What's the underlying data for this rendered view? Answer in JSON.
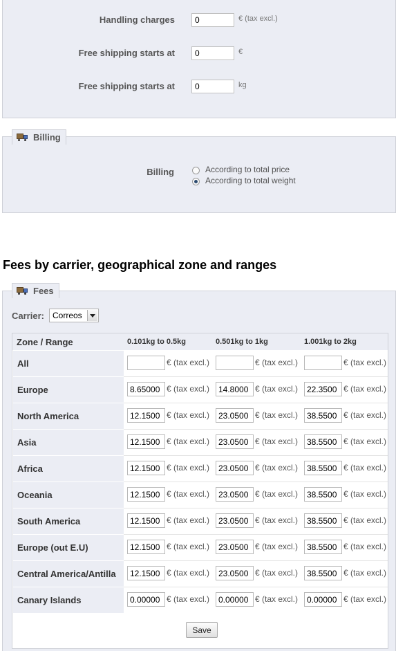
{
  "shipping": {
    "handling_label": "Handling charges",
    "handling_value": "0",
    "handling_unit": "€ (tax excl.)",
    "free_price_label": "Free shipping starts at",
    "free_price_value": "0",
    "free_price_unit": "€",
    "free_weight_label": "Free shipping starts at",
    "free_weight_value": "0",
    "free_weight_unit": "kg"
  },
  "billing": {
    "legend": "Billing",
    "label": "Billing",
    "options": [
      "According to total price",
      "According to total weight"
    ],
    "selected_index": 1
  },
  "fees": {
    "section_title": "Fees by carrier, geographical zone and ranges",
    "legend": "Fees",
    "carrier_label": "Carrier:",
    "carrier_value": "Correos",
    "header_zone": "Zone / Range",
    "ranges": [
      "0.101kg to 0.5kg",
      "0.501kg to 1kg",
      "1.001kg to 2kg"
    ],
    "unit": "€ (tax excl.)",
    "rows": [
      {
        "zone": "All",
        "values": [
          "",
          "",
          ""
        ]
      },
      {
        "zone": "Europe",
        "values": [
          "8.65000",
          "14.8000",
          "22.3500"
        ]
      },
      {
        "zone": "North America",
        "values": [
          "12.1500",
          "23.0500",
          "38.5500"
        ]
      },
      {
        "zone": "Asia",
        "values": [
          "12.1500",
          "23.0500",
          "38.5500"
        ]
      },
      {
        "zone": "Africa",
        "values": [
          "12.1500",
          "23.0500",
          "38.5500"
        ]
      },
      {
        "zone": "Oceania",
        "values": [
          "12.1500",
          "23.0500",
          "38.5500"
        ]
      },
      {
        "zone": "South America",
        "values": [
          "12.1500",
          "23.0500",
          "38.5500"
        ]
      },
      {
        "zone": "Europe (out E.U)",
        "values": [
          "12.1500",
          "23.0500",
          "38.5500"
        ]
      },
      {
        "zone": "Central America/Antilla",
        "values": [
          "12.1500",
          "23.0500",
          "38.5500"
        ]
      },
      {
        "zone": "Canary Islands",
        "values": [
          "0.00000",
          "0.00000",
          "0.00000"
        ]
      }
    ],
    "save_label": "Save"
  }
}
